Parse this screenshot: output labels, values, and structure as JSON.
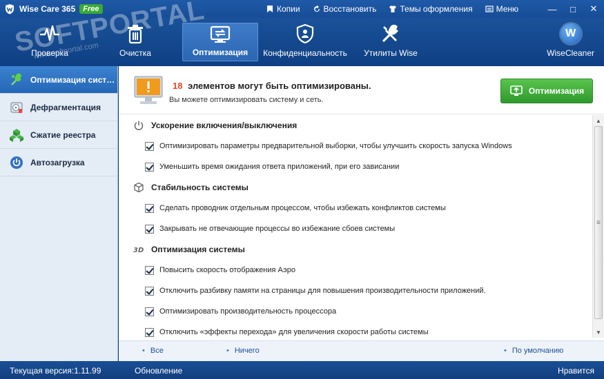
{
  "app": {
    "title": "Wise Care 365",
    "badge": "Free"
  },
  "title_menu": [
    {
      "label": "Копии",
      "icon": "bookmark-icon"
    },
    {
      "label": "Восстановить",
      "icon": "restore-icon"
    },
    {
      "label": "Темы оформления",
      "icon": "shirt-icon"
    },
    {
      "label": "Меню",
      "icon": "menu-icon"
    }
  ],
  "window_controls": {
    "minimize": "—",
    "maximize": "□",
    "close": "✕"
  },
  "watermark": {
    "main": "SOFTPORTAL",
    "sub": "www.softportal.com"
  },
  "nav": {
    "items": [
      {
        "label": "Проверка",
        "icon": "pulse-icon"
      },
      {
        "label": "Очистка",
        "icon": "trash-icon"
      },
      {
        "label": "Оптимизация",
        "icon": "optimize-icon",
        "active": true
      },
      {
        "label": "Конфиденциальность",
        "icon": "shield-icon"
      },
      {
        "label": "Утилиты Wise",
        "icon": "tools-icon"
      }
    ],
    "brand_label": "WiseCleaner",
    "brand_letter": "W"
  },
  "sidebar": {
    "items": [
      {
        "label": "Оптимизация системы",
        "icon": "system-optimize-icon",
        "active": true
      },
      {
        "label": "Дефрагментация",
        "icon": "defrag-icon"
      },
      {
        "label": "Сжатие реестра",
        "icon": "registry-icon"
      },
      {
        "label": "Автозагрузка",
        "icon": "power-icon"
      }
    ]
  },
  "banner": {
    "count": "18",
    "headline": "элементов могут быть оптимизированы.",
    "subtitle": "Вы можете оптимизировать систему и сеть.",
    "button_label": "Оптимизация"
  },
  "sections": [
    {
      "title": "Ускорение включения/выключения",
      "icon": "power-icon",
      "items": [
        {
          "label": "Оптимизировать параметры предварительной выборки, чтобы улучшить скорость запуска Windows",
          "checked": true
        },
        {
          "label": "Уменьшить время ожидания ответа приложений, при его зависании",
          "checked": true
        }
      ]
    },
    {
      "title": "Стабильность системы",
      "icon": "cube-icon",
      "items": [
        {
          "label": "Сделать проводник отдельным процессом, чтобы избежать конфликтов системы",
          "checked": true
        },
        {
          "label": "Закрывать не отвечающие процессы во избежание сбоев системы",
          "checked": true
        }
      ]
    },
    {
      "title": "Оптимизация системы",
      "icon": "3d-icon",
      "items": [
        {
          "label": "Повысить скорость отображения Аэро",
          "checked": true
        },
        {
          "label": "Отключить разбивку памяти на страницы для повышения производительности приложений.",
          "checked": true
        },
        {
          "label": "Оптимизировать производительность процессора",
          "checked": true
        },
        {
          "label": "Отключить «эффекты перехода» для увеличения скорости работы системы",
          "checked": true
        }
      ]
    }
  ],
  "footer_links": {
    "all": "Все",
    "none": "Ничего",
    "default": "По умолчанию"
  },
  "status": {
    "version": "Текущая версия:1.11.99",
    "update": "Обновление",
    "like": "Нравится"
  }
}
